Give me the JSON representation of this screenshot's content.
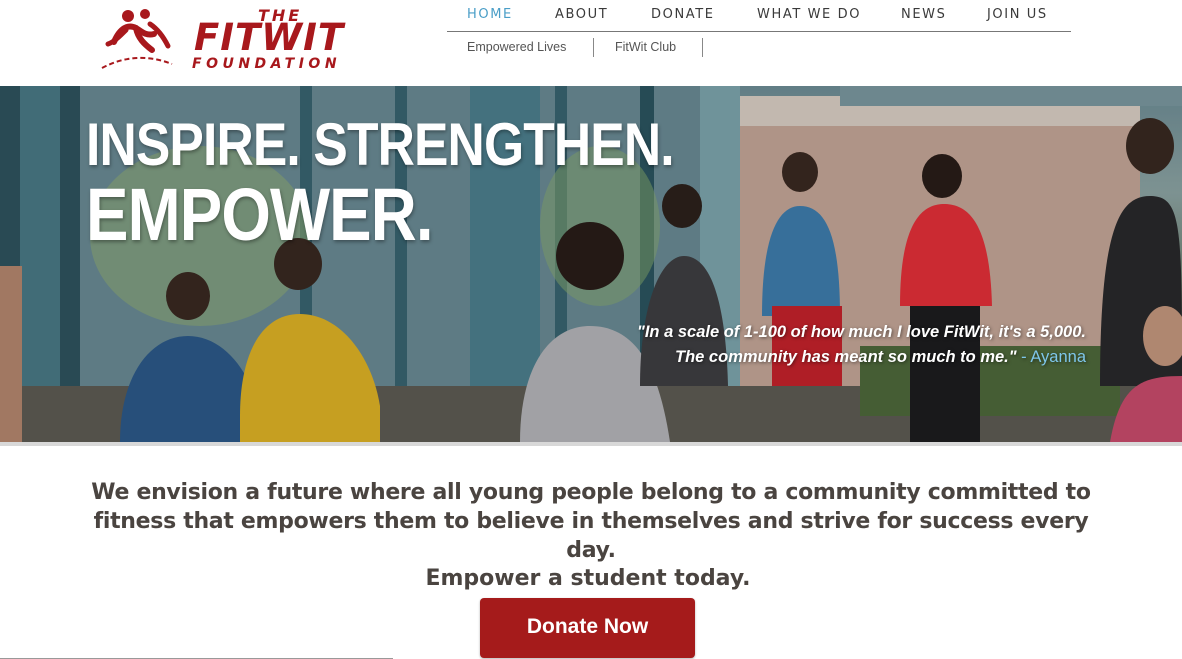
{
  "logo": {
    "the": "THE",
    "name": "FITWIT",
    "foundation": "FOUNDATION"
  },
  "nav": {
    "items": [
      {
        "label": "HOME",
        "active": true
      },
      {
        "label": "ABOUT",
        "active": false
      },
      {
        "label": "DONATE",
        "active": false
      },
      {
        "label": "WHAT WE DO",
        "active": false
      },
      {
        "label": "NEWS",
        "active": false
      },
      {
        "label": "JOIN US",
        "active": false
      }
    ],
    "sub_items": [
      {
        "label": "Empowered Lives"
      },
      {
        "label": "FitWit Club"
      }
    ]
  },
  "hero": {
    "headline_line1": "INSPIRE. STRENGTHEN.",
    "headline_line2": "EMPOWER.",
    "quote_line1": "\"In a scale of 1-100 of how much I love FitWit, it's a 5,000.",
    "quote_line2": "The community has meant so much to me.\"",
    "quote_author": " - Ayanna"
  },
  "mission": {
    "statement": "We envision a future where all young people belong to a community committed to fitness that empowers them to believe in themselves and strive for success every day.",
    "cta": "Empower a student today.",
    "button_label": "Donate Now"
  },
  "colors": {
    "brand_red": "#a8181c",
    "nav_active": "#4a9ec7",
    "button_red": "#a51b1b",
    "text_dark": "#4a4440"
  }
}
